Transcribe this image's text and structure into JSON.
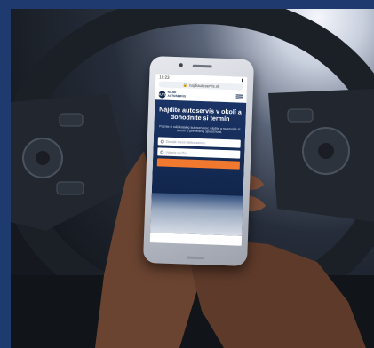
{
  "phone": {
    "status_time": "10:23",
    "url": "najdiautoservis.sk",
    "logo_mark": "AUTO",
    "logo_text_1": "NÁJDI",
    "logo_text_2": "AUTOSERVIS",
    "hero_title": "Nájdite autoservis v okolí a dohodnite si termín",
    "hero_subtitle": "Pozrite si náš katalóg autoservisov, nájdite a rezervujte si termín u preverenej spoločnosti.",
    "field_location": "Zadajte mesto alebo adresu",
    "field_service": "Vyberte službu"
  },
  "colors": {
    "frame": "#1f3a6e",
    "hero": "#13284f",
    "button": "#f0782f"
  }
}
